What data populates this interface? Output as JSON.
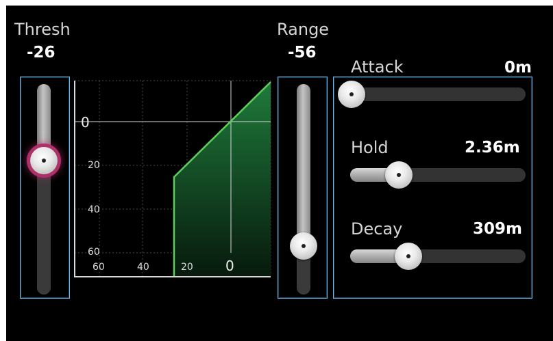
{
  "thresh": {
    "label": "Thresh",
    "value": "-26",
    "level": 0.68
  },
  "range": {
    "label": "Range",
    "value": "-56",
    "level": 0.22
  },
  "attack": {
    "label": "Attack",
    "value": "0m",
    "level": 0.0
  },
  "hold": {
    "label": "Hold",
    "value": "2.36m",
    "level": 0.27
  },
  "decay": {
    "label": "Decay",
    "value": "309m",
    "level": 0.33
  },
  "graph": {
    "y_ticks": [
      "0",
      "20",
      "40",
      "60"
    ],
    "x_ticks": [
      "60",
      "40",
      "20"
    ],
    "x_zero": "0"
  },
  "colors": {
    "frame": "#6fb8ea",
    "curve": "#5ecf5a",
    "fill_top": "#1f7a3b",
    "active_ring": "#b0306a"
  }
}
